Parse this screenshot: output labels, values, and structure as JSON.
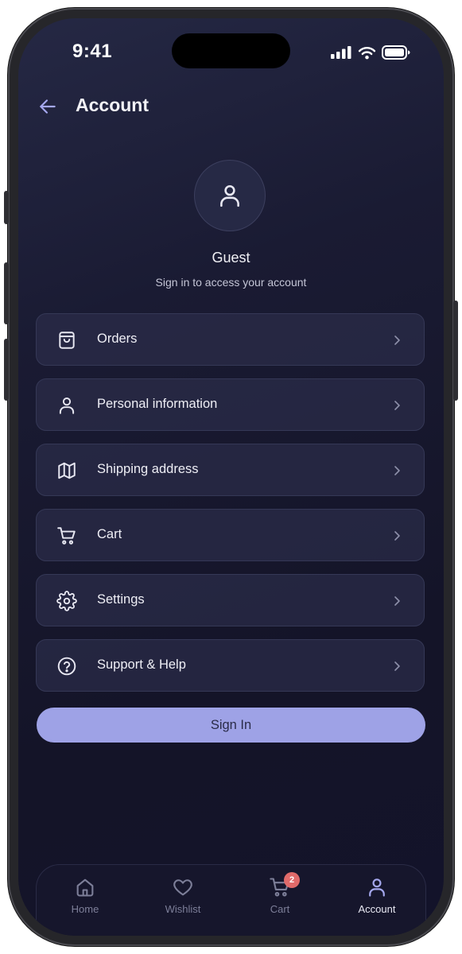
{
  "status_bar": {
    "time": "9:41"
  },
  "header": {
    "title": "Account"
  },
  "profile": {
    "name": "Guest",
    "subtitle": "Sign in to access your account"
  },
  "menu": {
    "items": [
      {
        "label": "Orders",
        "icon": "shopping-bag-icon"
      },
      {
        "label": "Personal information",
        "icon": "user-icon"
      },
      {
        "label": "Shipping address",
        "icon": "map-icon"
      },
      {
        "label": "Cart",
        "icon": "cart-icon"
      },
      {
        "label": "Settings",
        "icon": "gear-icon"
      },
      {
        "label": "Support & Help",
        "icon": "help-circle-icon"
      }
    ]
  },
  "sign_in": {
    "label": "Sign In"
  },
  "tabbar": {
    "tabs": [
      {
        "label": "Home",
        "icon": "home-icon"
      },
      {
        "label": "Wishlist",
        "icon": "heart-icon"
      },
      {
        "label": "Cart",
        "icon": "cart-icon",
        "badge": "2"
      },
      {
        "label": "Account",
        "icon": "user-icon",
        "active": true
      }
    ]
  },
  "colors": {
    "accent": "#9ea2e6",
    "badge": "#e06a6a",
    "background": "#16162c"
  }
}
